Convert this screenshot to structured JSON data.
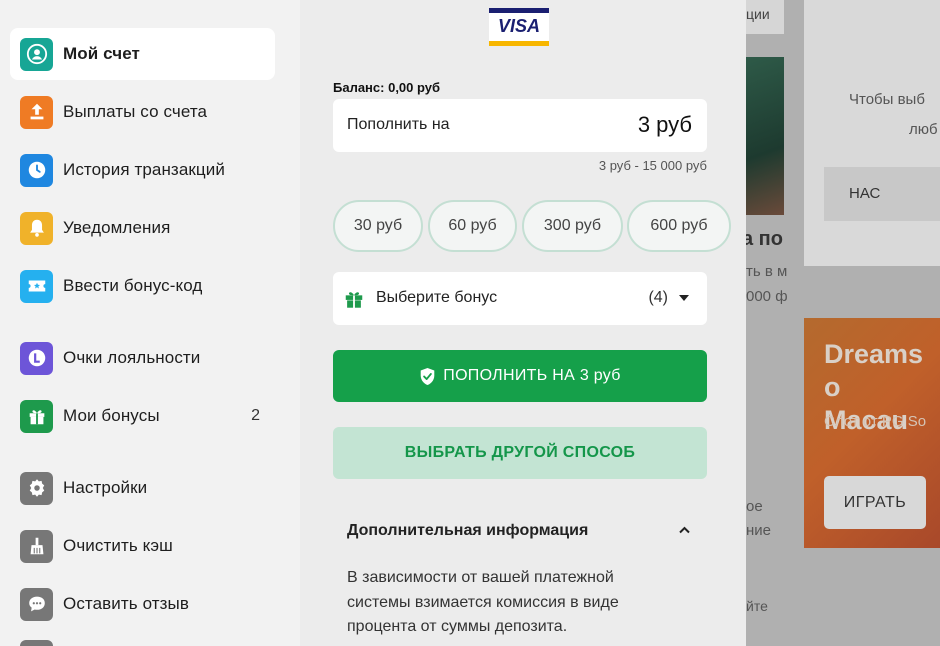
{
  "sidebar": {
    "items": [
      {
        "label": "Мой счет",
        "icon": "user-circle-icon",
        "color": "#17a695",
        "active": true
      },
      {
        "label": "Выплаты со счета",
        "icon": "upload-icon",
        "color": "#ef7b24"
      },
      {
        "label": "История транзакций",
        "icon": "clock-icon",
        "color": "#1f87e0"
      },
      {
        "label": "Уведомления",
        "icon": "bell-icon",
        "color": "#f0b22a"
      },
      {
        "label": "Ввести бонус-код",
        "icon": "ticket-icon",
        "color": "#25b0ef"
      },
      {
        "label": "Очки лояльности",
        "icon": "loyalty-icon",
        "color": "#6d55d8"
      },
      {
        "label": "Мои бонусы",
        "icon": "gift-icon",
        "color": "#1e9a4c",
        "count": "2"
      },
      {
        "label": "Настройки",
        "icon": "gear-icon",
        "color": "#777777"
      },
      {
        "label": "Очистить кэш",
        "icon": "broom-icon",
        "color": "#777777"
      },
      {
        "label": "Оставить отзыв",
        "icon": "chat-icon",
        "color": "#777777"
      }
    ]
  },
  "payment": {
    "method_logo": "VISA",
    "balance": "Баланс: 0,00 руб",
    "amount_label": "Пополнить на",
    "amount_value": "3 руб",
    "range": "3 руб - 15 000 руб",
    "presets": [
      "30 руб",
      "60 руб",
      "300 руб",
      "600 руб"
    ],
    "bonus_label": "Выберите бонус",
    "bonus_count": "(4)",
    "deposit_button": "ПОПОЛНИТЬ НА 3 руб",
    "other_method_button": "ВЫБРАТЬ ДРУГОЙ СПОСОБ",
    "info_title": "Дополнительная информация",
    "info_text": "В зависимости от вашей платежной системы взимается комиссия в виде процента от суммы депозита."
  },
  "background": {
    "tab_text": "ции",
    "card_text_1": "Чтобы выб",
    "card_text_2": "люб",
    "button_text": "НАС",
    "heading": "а по",
    "line_1": "ть в м",
    "line_2": "000 ф",
    "frag_1": "ое",
    "frag_2": "ние",
    "frag_3": "йте",
    "promo_title_1": "Dreams o",
    "promo_title_2": "Macau",
    "promo_sub": "Слот от PG So",
    "play_button": "ИГРАТЬ"
  },
  "colors": {
    "accent": "#15a04a",
    "secondary_button": "#c3e4d3"
  }
}
